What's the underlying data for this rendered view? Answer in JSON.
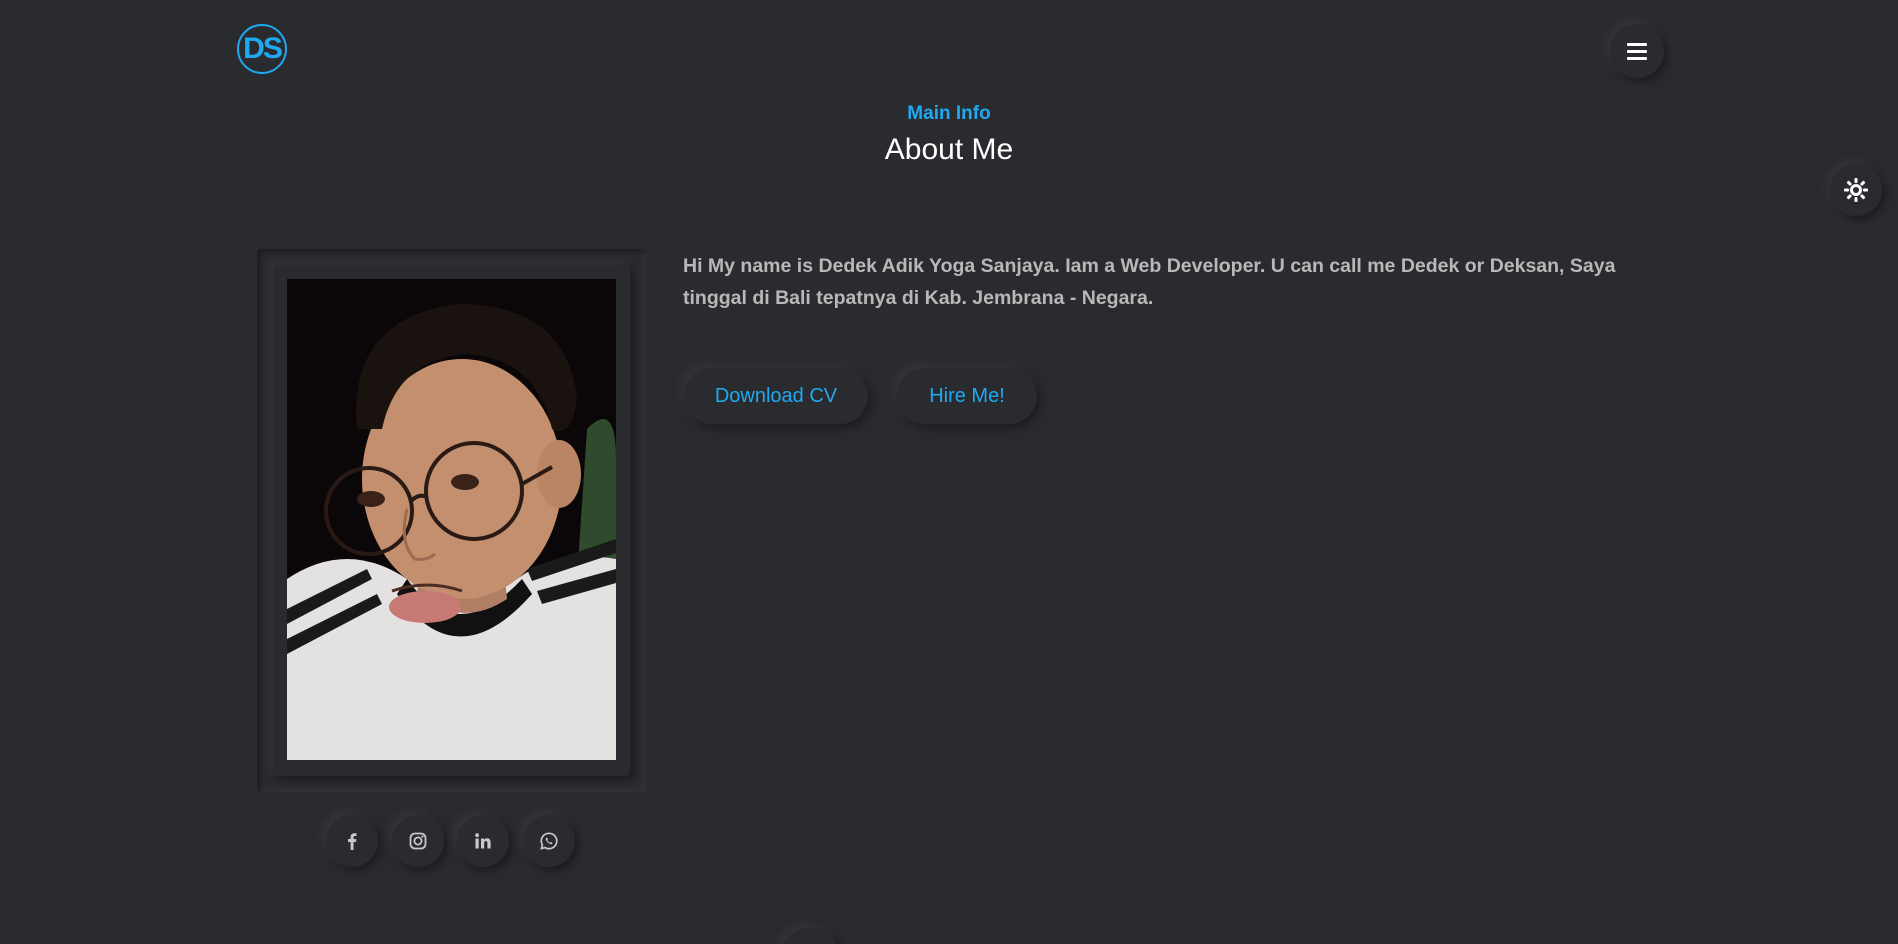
{
  "header": {
    "logo_text": "DS",
    "menu_icon": "hamburger-icon"
  },
  "theme_toggle": {
    "icon": "sun-icon"
  },
  "section": {
    "subtitle": "Main Info",
    "title": "About Me"
  },
  "about": {
    "description": "Hi My name is Dedek Adik Yoga Sanjaya. Iam a Web Developer. U can call me Dedek or Deksan, Saya tinggal di Bali tepatnya di Kab. Jembrana - Negara.",
    "buttons": {
      "download_cv": "Download CV",
      "hire_me": "Hire Me!"
    }
  },
  "social": [
    {
      "icon": "facebook-icon"
    },
    {
      "icon": "instagram-icon"
    },
    {
      "icon": "linkedin-icon"
    },
    {
      "icon": "whatsapp-icon"
    }
  ],
  "colors": {
    "accent": "#1fa9f0",
    "background": "#2a2b2f",
    "text_muted": "#b8b8b8"
  }
}
